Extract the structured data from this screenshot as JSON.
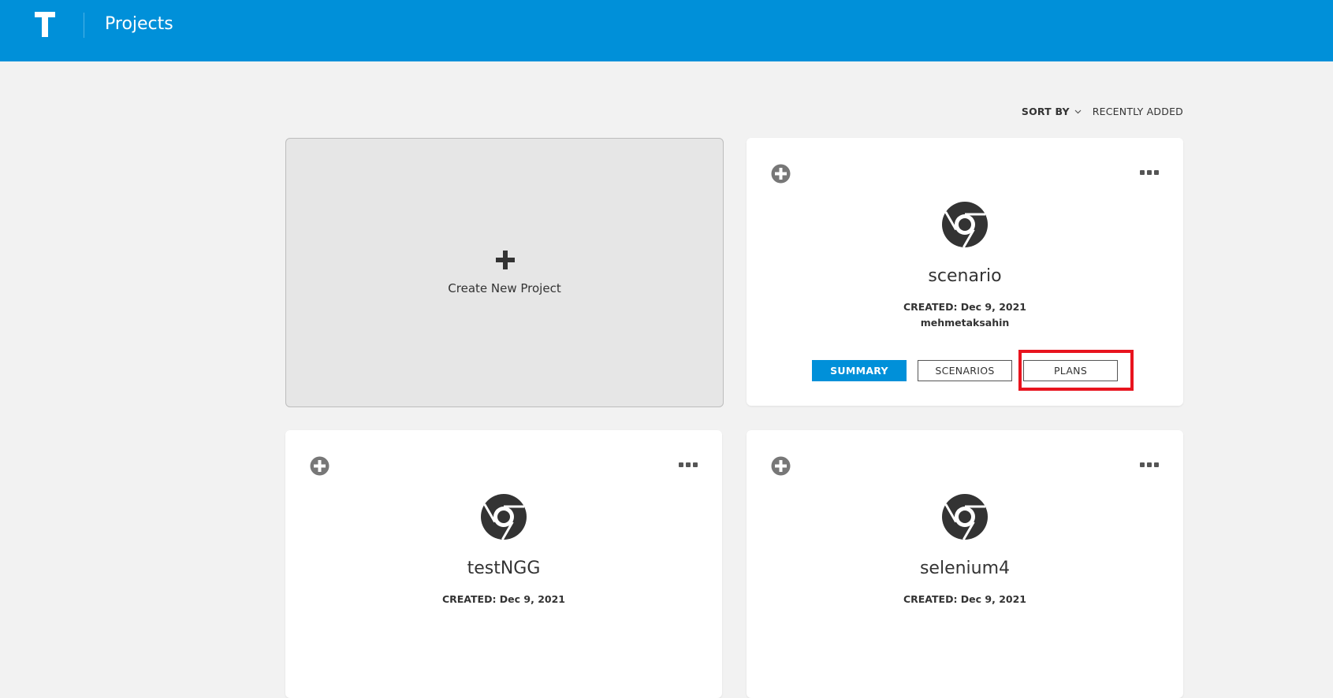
{
  "header": {
    "logo_letter": "T",
    "title": "Projects",
    "background": "#0090d9"
  },
  "sort": {
    "label": "SORT BY",
    "value": "RECENTLY ADDED",
    "icon": "chevron-down-icon"
  },
  "create_card": {
    "label": "Create New Project",
    "icon": "plus-icon"
  },
  "projects": [
    {
      "name": "scenario",
      "created": "CREATED: Dec 9, 2021",
      "owner": "mehmetaksahin",
      "buttons": {
        "summary": "SUMMARY",
        "scenarios": "SCENARIOS",
        "plans": "PLANS"
      }
    },
    {
      "name": "testNGG",
      "created": "CREATED: Dec 9, 2021"
    },
    {
      "name": "selenium4",
      "created": "CREATED: Dec 9, 2021"
    }
  ],
  "colors": {
    "accent": "#0090d9",
    "highlight": "#e8141e",
    "page_bg": "#f2f2f2"
  }
}
